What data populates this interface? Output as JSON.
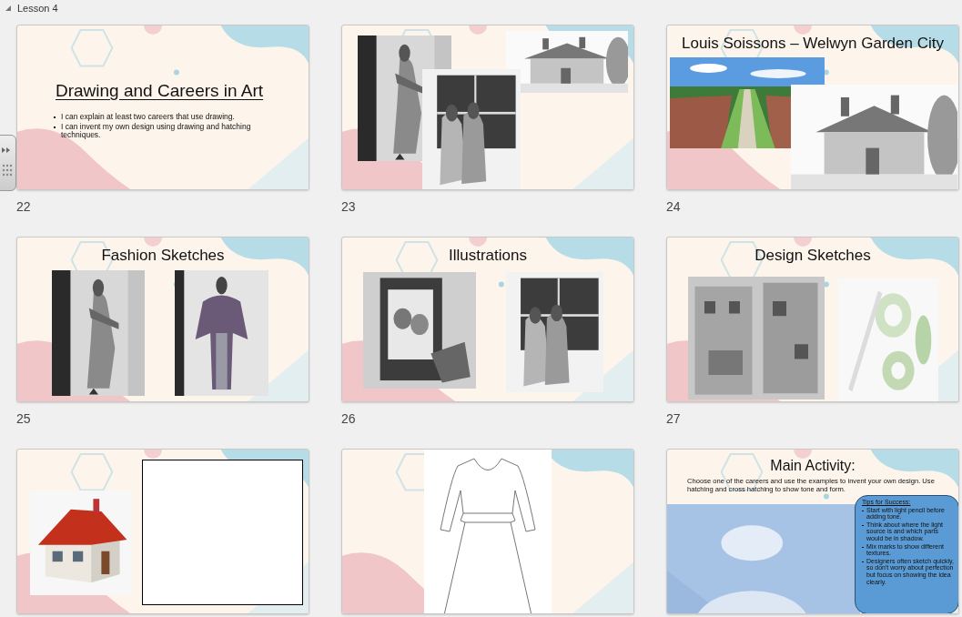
{
  "section": {
    "title": "Lesson 4",
    "expanded": true
  },
  "slides": [
    {
      "number": "22",
      "selected": false,
      "title": "Drawing and Careers in Art",
      "bullets": [
        "I can explain at least two careers that use drawing.",
        "I can invent my own design using drawing and hatching techniques."
      ]
    },
    {
      "number": "23",
      "selected": false,
      "items": [
        {
          "kind": "picture"
        },
        {
          "kind": "picture"
        },
        {
          "kind": "picture"
        }
      ]
    },
    {
      "number": "24",
      "selected": false,
      "title": "Louis Soissons – Welwyn Garden City",
      "items": [
        {
          "kind": "picture"
        },
        {
          "kind": "picture"
        }
      ]
    },
    {
      "number": "25",
      "selected": false,
      "title": "Fashion Sketches",
      "items": [
        {
          "kind": "picture"
        },
        {
          "kind": "picture"
        }
      ]
    },
    {
      "number": "26",
      "selected": false,
      "title": "Illustrations",
      "items": [
        {
          "kind": "picture"
        },
        {
          "kind": "picture"
        }
      ]
    },
    {
      "number": "27",
      "selected": false,
      "title": "Design Sketches",
      "items": [
        {
          "kind": "picture"
        },
        {
          "kind": "picture"
        }
      ]
    },
    {
      "selected": false,
      "items": [
        {
          "kind": "picture"
        },
        {
          "kind": "frame"
        }
      ]
    },
    {
      "selected": false,
      "items": [
        {
          "kind": "dress"
        }
      ]
    },
    {
      "selected": false,
      "title": "Main Activity:",
      "body": "Choose one of the careers and use the examples to invent your own design. Use hatching and cross hatching to show tone and form.",
      "items": [
        {
          "kind": "picture"
        },
        {
          "kind": "tips",
          "heading": "Tips for Success:",
          "lines": [
            "Start with light pencil before adding tone.",
            "Think about where the light source is and which parts would be in shadow.",
            "Mix marks to show different textures.",
            "Designers often sketch quickly, so don't worry about perfection but focus on showing the idea clearly."
          ]
        }
      ]
    }
  ]
}
